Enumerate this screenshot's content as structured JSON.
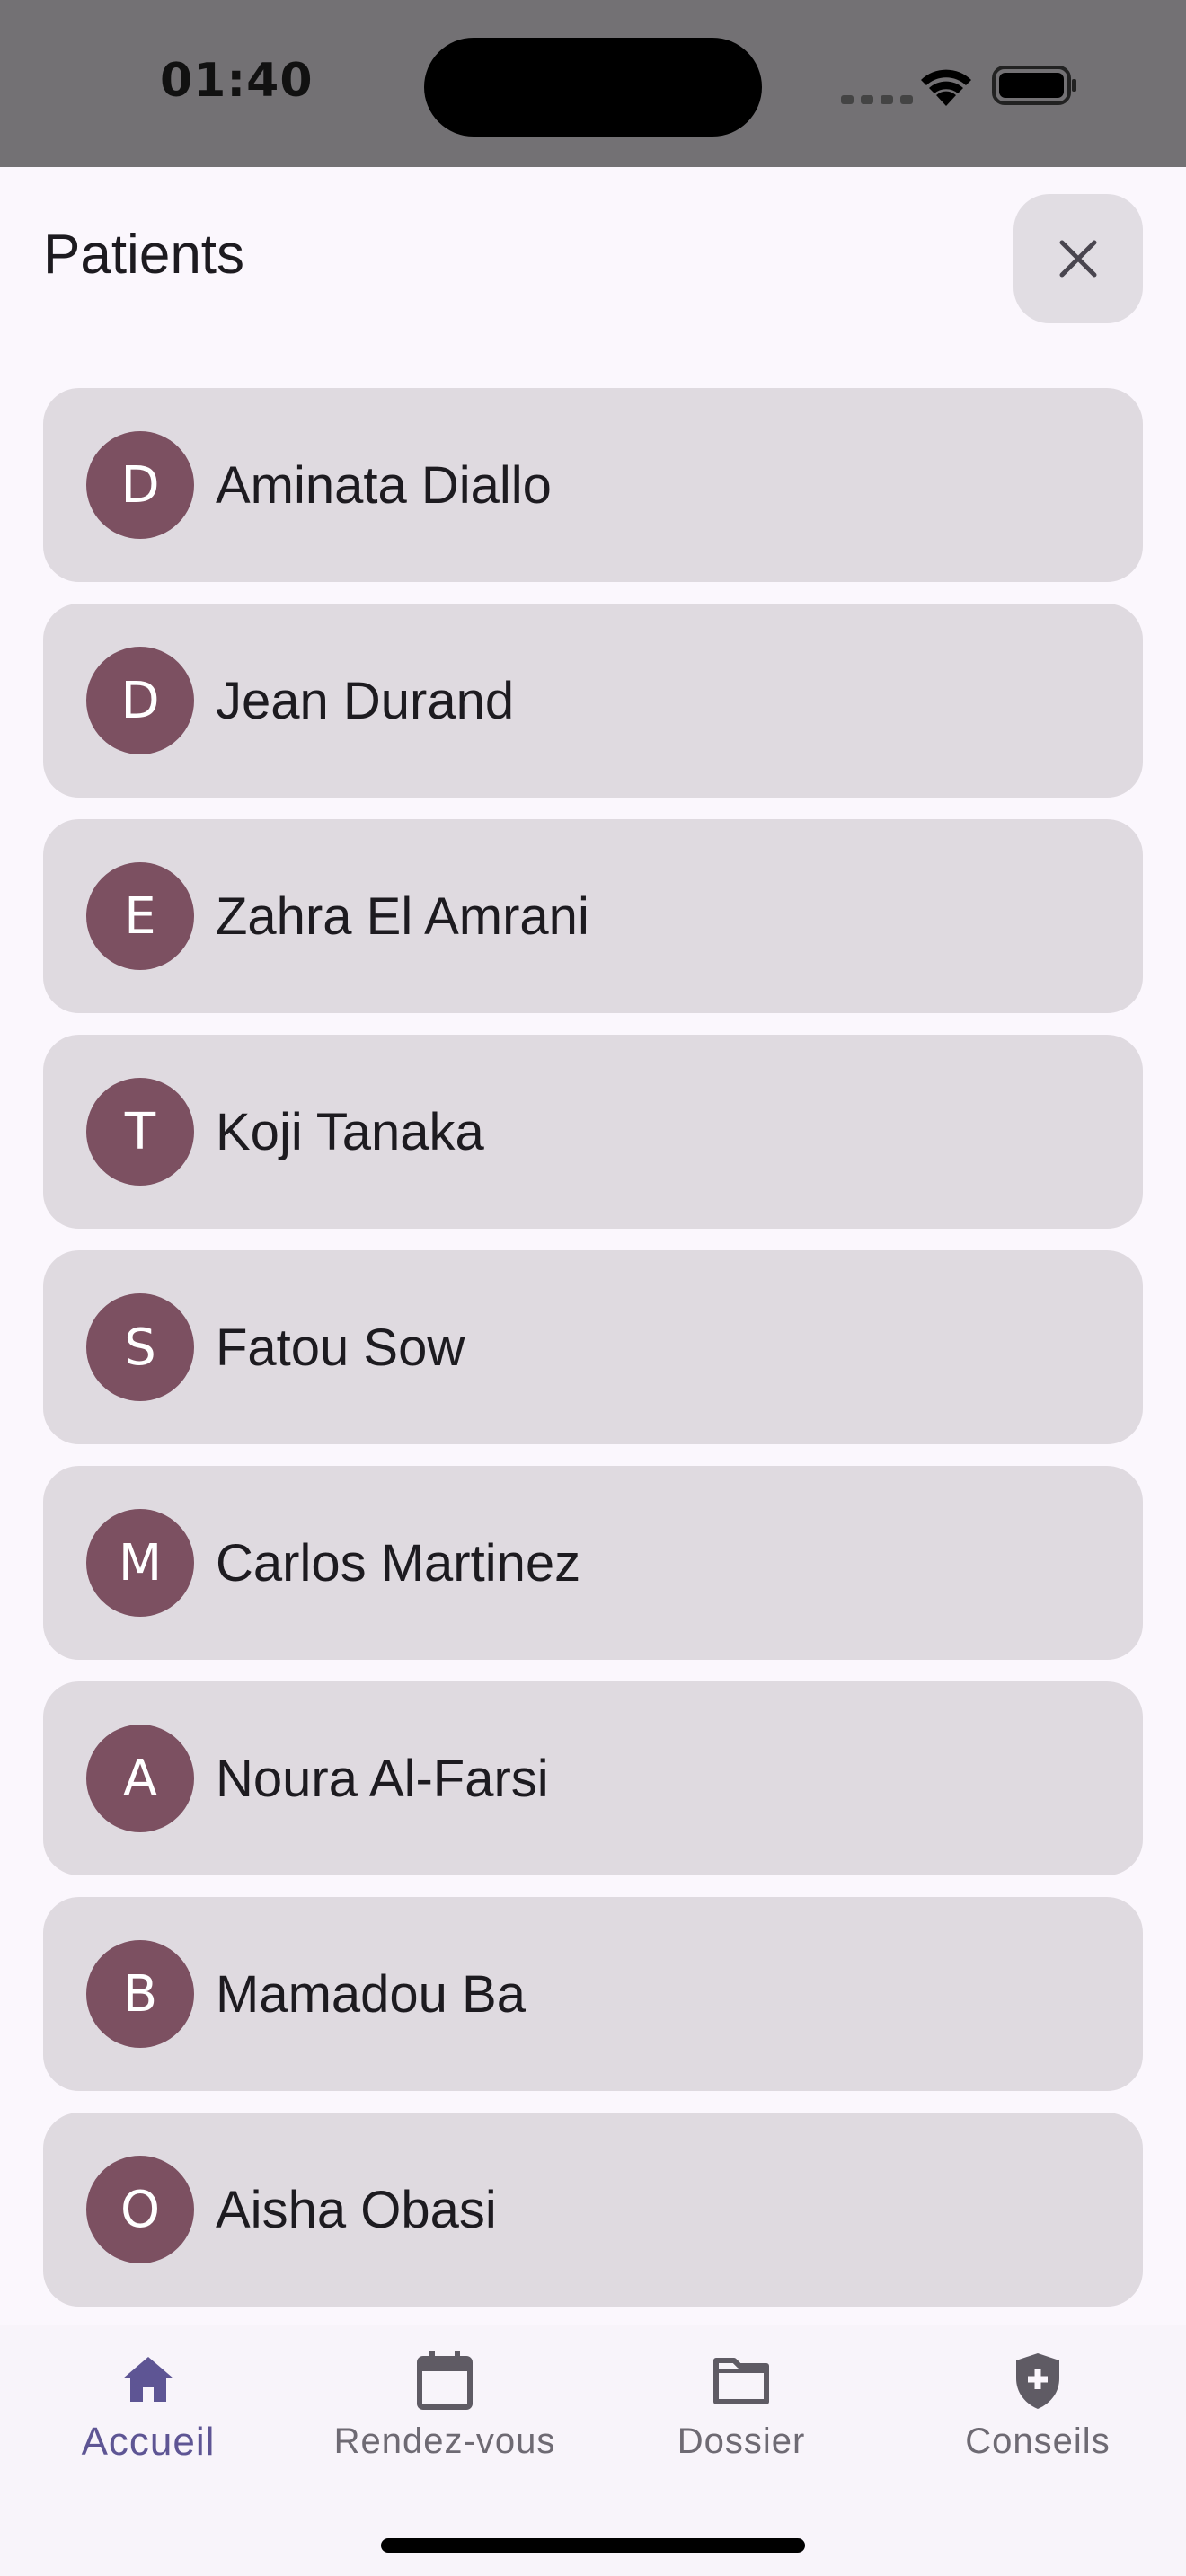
{
  "status_bar": {
    "time": "01:40"
  },
  "header": {
    "title": "Patients",
    "close_icon": "close-icon"
  },
  "patients": [
    {
      "initial": "D",
      "name": "Aminata Diallo"
    },
    {
      "initial": "D",
      "name": "Jean Durand"
    },
    {
      "initial": "E",
      "name": "Zahra El Amrani"
    },
    {
      "initial": "T",
      "name": "Koji Tanaka"
    },
    {
      "initial": "S",
      "name": "Fatou Sow"
    },
    {
      "initial": "M",
      "name": "Carlos Martinez"
    },
    {
      "initial": "A",
      "name": "Noura Al-Farsi"
    },
    {
      "initial": "B",
      "name": "Mamadou Ba"
    },
    {
      "initial": "O",
      "name": "Aisha Obasi"
    }
  ],
  "nav": {
    "items": [
      {
        "label": "Accueil",
        "icon": "home-icon",
        "active": true
      },
      {
        "label": "Rendez-vous",
        "icon": "calendar-icon",
        "active": false
      },
      {
        "label": "Dossier",
        "icon": "folder-icon",
        "active": false
      },
      {
        "label": "Conseils",
        "icon": "shield-plus-icon",
        "active": false
      }
    ]
  },
  "colors": {
    "background": "#fbf7fd",
    "card": "#dfdae0",
    "avatar": "#7c5061",
    "active_nav": "#5e5594",
    "inactive_nav": "#6e6a73"
  }
}
